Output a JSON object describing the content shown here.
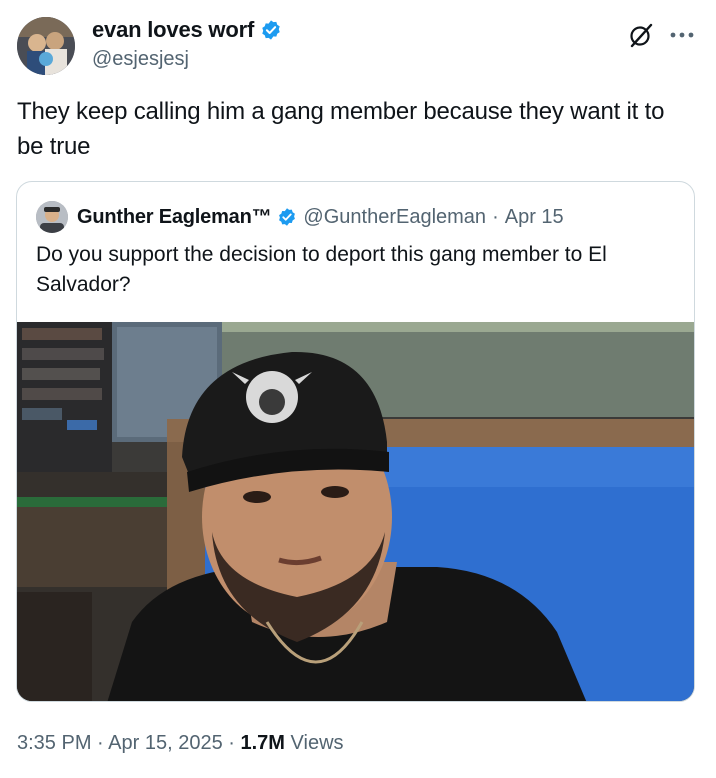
{
  "author": {
    "name": "evan loves worf",
    "handle": "@esjesjesj",
    "verified": true
  },
  "tweet": {
    "text": "They keep calling him a gang member because they want it to be true"
  },
  "quoted": {
    "name": "Gunther Eagleman™",
    "handle": "@GuntherEagleman",
    "separator": "·",
    "date": "Apr 15",
    "verified": true,
    "text": "Do you support the decision to deport this gang member to El Salvador?"
  },
  "footer": {
    "time": "3:35 PM",
    "dot1": "·",
    "date": "Apr 15, 2025",
    "dot2": "·",
    "views_count": "1.7M",
    "views_label": "Views"
  },
  "icons": {
    "verified": "verified-badge-icon",
    "grok": "grok-icon",
    "more": "more-icon"
  },
  "colors": {
    "accent": "#1d9bf0",
    "text": "#0f1419",
    "secondary": "#536471",
    "border": "#cfd9de"
  }
}
